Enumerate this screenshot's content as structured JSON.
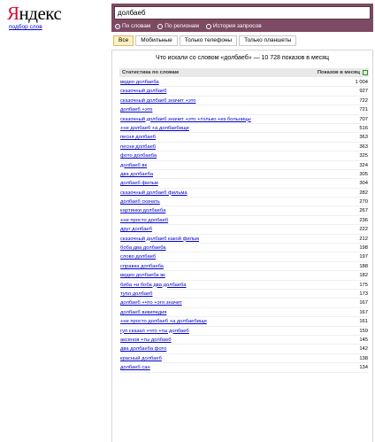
{
  "header": {
    "logo_first": "Я",
    "logo_rest": "ндекс",
    "subtitle": "подбор слов"
  },
  "search": {
    "value": "долбаеб",
    "radios": [
      {
        "label": "По словам",
        "selected": true
      },
      {
        "label": "По регионам",
        "selected": false
      },
      {
        "label": "История запросов",
        "selected": false
      }
    ]
  },
  "tabs": [
    {
      "label": "Все",
      "active": true
    },
    {
      "label": "Мобильные",
      "active": false
    },
    {
      "label": "Только телефоны",
      "active": false
    },
    {
      "label": "Только планшеты",
      "active": false
    }
  ],
  "panel": {
    "title": "Что искали со словом «долбаеб» — 10 728 показов в месяц",
    "col_phrase": "Статистика по словам",
    "col_count": "Показов в месяц"
  },
  "rows": [
    {
      "phrase": "видео долбаеба",
      "count": "1 004"
    },
    {
      "phrase": "сказочный долбаеб",
      "count": "927"
    },
    {
      "phrase": "сказочный долбаеб значит +это",
      "count": "722"
    },
    {
      "phrase": "долбаеб +это",
      "count": "721"
    },
    {
      "phrase": "сказочный долбаеб значит +это +только +из больницы",
      "count": "707"
    },
    {
      "phrase": "+не долбаеб +а долбаебище",
      "count": "516"
    },
    {
      "phrase": "песня долбаеб",
      "count": "363"
    },
    {
      "phrase": "песни долбаеб",
      "count": "363"
    },
    {
      "phrase": "фото долбаеба",
      "count": "325"
    },
    {
      "phrase": "долбаеб вк",
      "count": "324"
    },
    {
      "phrase": "два долбаеба",
      "count": "305"
    },
    {
      "phrase": "долбаеб фильм",
      "count": "304"
    },
    {
      "phrase": "сказочный долбаеб фильма",
      "count": "282"
    },
    {
      "phrase": "долбаеб скачать",
      "count": "270"
    },
    {
      "phrase": "картинки долбаеба",
      "count": "267"
    },
    {
      "phrase": "+не просто долбаеб",
      "count": "236"
    },
    {
      "phrase": "друг долбаеб",
      "count": "222"
    },
    {
      "phrase": "сказочный долбаеб какой фильм",
      "count": "212"
    },
    {
      "phrase": "боба два долбаеба",
      "count": "198"
    },
    {
      "phrase": "слово долбаеб",
      "count": "197"
    },
    {
      "phrase": "справка долбаеба",
      "count": "188"
    },
    {
      "phrase": "видео долбаеба вк",
      "count": "182"
    },
    {
      "phrase": "биба +и боба два долбаеба",
      "count": "175"
    },
    {
      "phrase": "тупл долбаеб",
      "count": "173"
    },
    {
      "phrase": "долбаеб +что +это значит",
      "count": "167"
    },
    {
      "phrase": "долбаеб википедия",
      "count": "167"
    },
    {
      "phrase": "+не просто долбаеб +а долбаебище",
      "count": "161"
    },
    {
      "phrase": "гуп сказал +что +ты долбаеб",
      "count": "159"
    },
    {
      "phrase": "аксенов +ты долбаеб",
      "count": "145"
    },
    {
      "phrase": "два долбаеба фото",
      "count": "142"
    },
    {
      "phrase": "красный долбаеб",
      "count": "138"
    },
    {
      "phrase": "долбаеб сан",
      "count": "134"
    }
  ],
  "colors": {
    "brand_red": "#e4002b",
    "search_bar": "#7d4a63",
    "link": "#0000cc",
    "active_tab": "#fff1c2"
  }
}
